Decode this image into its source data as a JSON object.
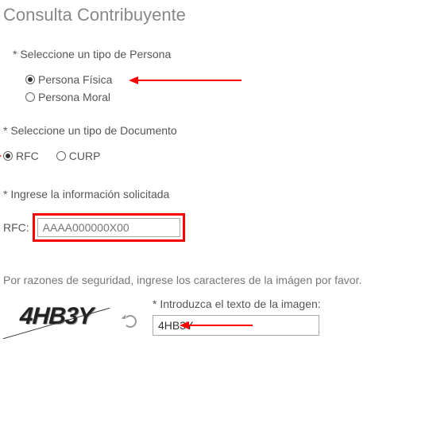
{
  "title": "Consulta Contribuyente",
  "sections": {
    "persona": {
      "label": "* Seleccione un tipo de Persona",
      "options": {
        "fisica": {
          "label": "Persona Física",
          "selected": true
        },
        "moral": {
          "label": "Persona Moral",
          "selected": false
        }
      }
    },
    "documento": {
      "label": "* Seleccione un tipo de Documento",
      "options": {
        "rfc": {
          "label": "RFC",
          "selected": true
        },
        "curp": {
          "label": "CURP",
          "selected": false
        }
      }
    },
    "info": {
      "label": "* Ingrese la información solicitada",
      "rfc_label": "RFC:",
      "rfc_placeholder": "AAAA000000X00"
    },
    "security": {
      "text": "Por razones de seguridad, ingrese los caracteres de la imágen por favor.",
      "captcha_image_text": "4HB3Y",
      "captcha_label": "* Introduzca el texto de la imagen:",
      "captcha_value": "4HB3Y"
    }
  }
}
